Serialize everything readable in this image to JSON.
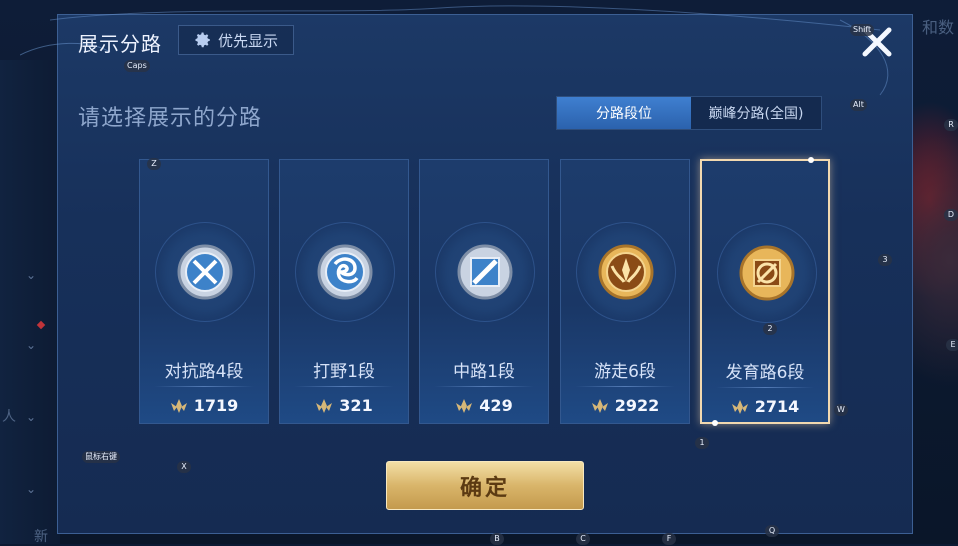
{
  "dialog": {
    "title": "展示分路",
    "priority_label": "优先显示",
    "subtitle": "请选择展示的分路",
    "confirm_label": "确定"
  },
  "toggle": {
    "tabs": [
      {
        "label": "分路段位",
        "active": true
      },
      {
        "label": "巅峰分路(全国)",
        "active": false
      }
    ]
  },
  "lanes": [
    {
      "label": "对抗路4段",
      "score": "1719",
      "tier": "silver",
      "icon": "clash-lane-icon",
      "selected": false
    },
    {
      "label": "打野1段",
      "score": "321",
      "tier": "silver",
      "icon": "jungle-dragon-icon",
      "selected": false
    },
    {
      "label": "中路1段",
      "score": "429",
      "tier": "silver",
      "icon": "mid-lane-icon",
      "selected": false
    },
    {
      "label": "游走6段",
      "score": "2922",
      "tier": "gold",
      "icon": "roam-wings-icon",
      "selected": false
    },
    {
      "label": "发育路6段",
      "score": "2714",
      "tier": "gold",
      "icon": "farm-lane-icon",
      "selected": true
    }
  ],
  "key_hints": [
    {
      "label": "Caps"
    },
    {
      "label": "Shift"
    },
    {
      "label": "Alt"
    },
    {
      "label": "R"
    },
    {
      "label": "D"
    },
    {
      "label": "3"
    },
    {
      "label": "E"
    },
    {
      "label": "Z"
    },
    {
      "label": "2"
    },
    {
      "label": "W"
    },
    {
      "label": "1"
    },
    {
      "label": "鼠标右键"
    },
    {
      "label": "X"
    },
    {
      "label": "B"
    },
    {
      "label": "C"
    },
    {
      "label": "F"
    },
    {
      "label": "Q"
    }
  ],
  "background": {
    "top_right_text": "和数",
    "side_char_1": "人",
    "side_char_2": "新"
  },
  "colors": {
    "accent_blue": "#3f7fd0",
    "gold": "#d9b56a",
    "selected_border": "#f2d9b0",
    "panel": "#1c3966"
  }
}
